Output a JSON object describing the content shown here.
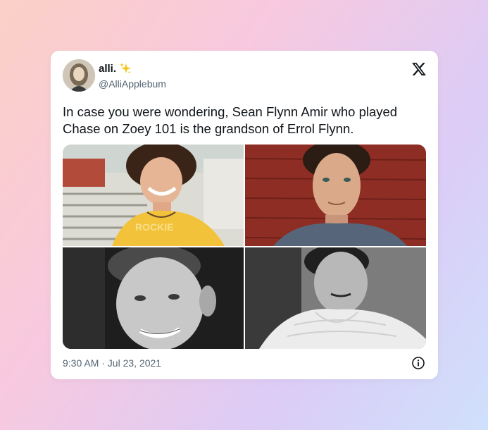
{
  "tweet": {
    "author_name": "alli.",
    "author_emoji": "sparkles-icon",
    "author_handle": "@AlliApplebum",
    "text": "In case you were wondering, Sean Flynn Amir who played Chase on Zoey 101 is the grandson of Errol Flynn.",
    "timestamp": "9:30 AM · Jul 23, 2021",
    "photos": [
      {
        "name": "photo-young-actor-yellow-shirt",
        "shirt_text": "ROCKIE"
      },
      {
        "name": "photo-man-red-wall"
      },
      {
        "name": "photo-bw-man-smiling"
      },
      {
        "name": "photo-bw-man-white-sweater"
      }
    ]
  },
  "icons": {
    "platform_logo": "x-logo-icon",
    "info": "info-icon"
  },
  "colors": {
    "text_primary": "#0f1419",
    "text_secondary": "#536471",
    "card_background": "#ffffff"
  }
}
